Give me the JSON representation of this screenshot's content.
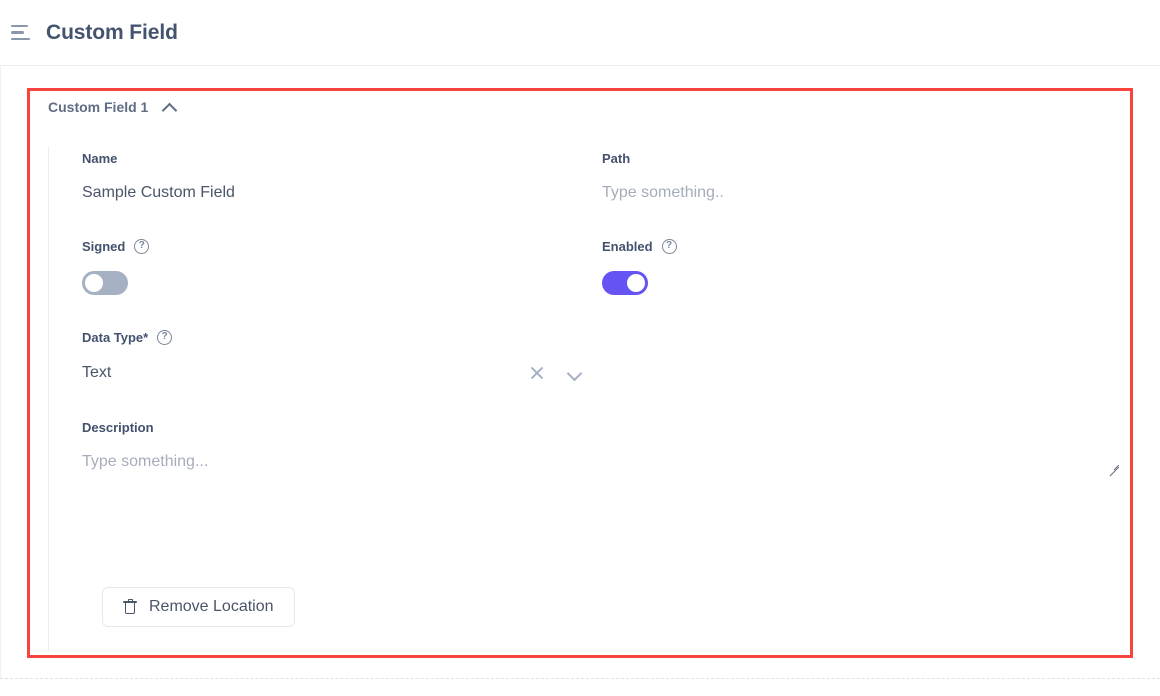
{
  "header": {
    "menu_icon": "hamburger-menu-icon",
    "title": "Custom Field"
  },
  "accordion": {
    "title": "Custom Field 1",
    "collapse_icon": "chevron-up-icon",
    "expanded": true
  },
  "fields": {
    "name": {
      "label": "Name",
      "value": "Sample Custom Field"
    },
    "path": {
      "label": "Path",
      "value": "",
      "placeholder": "Type something.."
    },
    "signed": {
      "label": "Signed",
      "help_icon": "help-circle-icon",
      "toggle_state": "off"
    },
    "enabled": {
      "label": "Enabled",
      "help_icon": "help-circle-icon",
      "toggle_state": "on"
    },
    "data_type": {
      "label": "Data Type*",
      "help_icon": "help-circle-icon",
      "value": "Text",
      "clear_icon": "close-x-icon",
      "dropdown_icon": "chevron-down-icon"
    },
    "description": {
      "label": "Description",
      "value": "",
      "placeholder": "Type something...",
      "resize_icon": "resize-grip-icon"
    }
  },
  "actions": {
    "remove_location": {
      "label": "Remove Location",
      "icon": "trash-icon"
    }
  },
  "colors": {
    "accent_purple": "#6554f3",
    "toggle_off_grey": "#a6b0c3",
    "highlight_red": "#f8443f",
    "label_text": "#42526e",
    "placeholder_text": "#a5adba"
  }
}
